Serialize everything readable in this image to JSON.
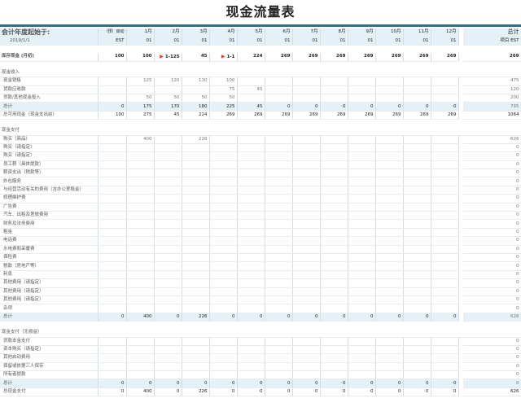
{
  "title": "现金流量表",
  "header": {
    "fiscal_label": "会计年度起始于:",
    "fiscal_date": "2019/1/1",
    "pre_label": "（预）启动",
    "pre_sub": "EST",
    "months": [
      "1月",
      "2月",
      "3月",
      "4月",
      "5月",
      "6月",
      "7月",
      "8月",
      "9月",
      "10月",
      "11月",
      "12月"
    ],
    "month_sub": "01",
    "total_label": "总计",
    "total_sub": "项目 EST"
  },
  "opening": {
    "label": "库存现金 (月初)",
    "pre": "100",
    "months": [
      "100",
      "1-125",
      "45",
      "1-1",
      "224",
      "269",
      "269",
      "269",
      "269",
      "269",
      "269",
      "269"
    ],
    "total": "269"
  },
  "receipts": {
    "section_label": "现金收入",
    "rows": [
      {
        "label": "现金销售",
        "pre": "",
        "months": [
          "125",
          "120",
          "130",
          "100",
          "",
          "",
          "",
          "",
          "",
          "",
          "",
          ""
        ],
        "total": "475"
      },
      {
        "label": "货款应收款",
        "pre": "",
        "months": [
          "",
          "",
          "",
          "75",
          "45",
          "",
          "",
          "",
          "",
          "",
          "",
          ""
        ],
        "total": "120"
      },
      {
        "label": "贷款/其他现金投入",
        "pre": "",
        "months": [
          "50",
          "50",
          "50",
          "50",
          "",
          "",
          "",
          "",
          "",
          "",
          "",
          ""
        ],
        "total": "200"
      }
    ],
    "subtotal": {
      "label": "总计",
      "pre": "0",
      "months": [
        "175",
        "170",
        "180",
        "225",
        "45",
        "0",
        "0",
        "0",
        "0",
        "0",
        "0",
        "0"
      ],
      "total": "795"
    },
    "available": {
      "label": "总可用现金（现金支出前）",
      "pre": "100",
      "months": [
        "275",
        "45",
        "224",
        "269",
        "269",
        "269",
        "269",
        "269",
        "269",
        "269",
        "269",
        "269"
      ],
      "total": "1064"
    }
  },
  "payments": {
    "section_label": "现金支付",
    "rows": [
      {
        "label": "购买（商品）",
        "pre": "",
        "months": [
          "400",
          "",
          "226",
          "",
          "",
          "",
          "",
          "",
          "",
          "",
          "",
          ""
        ],
        "total": "626"
      },
      {
        "label": "购买（请指定）",
        "pre": "",
        "months": [
          "",
          "",
          "",
          "",
          "",
          "",
          "",
          "",
          "",
          "",
          "",
          ""
        ],
        "total": "0"
      },
      {
        "label": "购买（请指定）",
        "pre": "",
        "months": [
          "",
          "",
          "",
          "",
          "",
          "",
          "",
          "",
          "",
          "",
          "",
          ""
        ],
        "total": "0"
      },
      {
        "label": "员工薪（具体提款）",
        "pre": "",
        "months": [
          "",
          "",
          "",
          "",
          "",
          "",
          "",
          "",
          "",
          "",
          "",
          ""
        ],
        "total": "0"
      },
      {
        "label": "薪资支出（税款等）",
        "pre": "",
        "months": [
          "",
          "",
          "",
          "",
          "",
          "",
          "",
          "",
          "",
          "",
          "",
          ""
        ],
        "total": "0"
      },
      {
        "label": "外包服务",
        "pre": "",
        "months": [
          "",
          "",
          "",
          "",
          "",
          "",
          "",
          "",
          "",
          "",
          "",
          ""
        ],
        "total": "0"
      },
      {
        "label": "与经营活动有关的费用（含办公室租金）",
        "pre": "",
        "months": [
          "",
          "",
          "",
          "",
          "",
          "",
          "",
          "",
          "",
          "",
          "",
          ""
        ],
        "total": "0"
      },
      {
        "label": "修理维护费",
        "pre": "",
        "months": [
          "",
          "",
          "",
          "",
          "",
          "",
          "",
          "",
          "",
          "",
          "",
          ""
        ],
        "total": "0"
      },
      {
        "label": "广告费",
        "pre": "",
        "months": [
          "",
          "",
          "",
          "",
          "",
          "",
          "",
          "",
          "",
          "",
          "",
          ""
        ],
        "total": "0"
      },
      {
        "label": "汽车、出租及差旅费用",
        "pre": "",
        "months": [
          "",
          "",
          "",
          "",
          "",
          "",
          "",
          "",
          "",
          "",
          "",
          ""
        ],
        "total": "0"
      },
      {
        "label": "财务及法务费用",
        "pre": "",
        "months": [
          "",
          "",
          "",
          "",
          "",
          "",
          "",
          "",
          "",
          "",
          "",
          ""
        ],
        "total": "0"
      },
      {
        "label": "租金",
        "pre": "",
        "months": [
          "",
          "",
          "",
          "",
          "",
          "",
          "",
          "",
          "",
          "",
          "",
          ""
        ],
        "total": "0"
      },
      {
        "label": "电话费",
        "pre": "",
        "months": [
          "",
          "",
          "",
          "",
          "",
          "",
          "",
          "",
          "",
          "",
          "",
          ""
        ],
        "total": "0"
      },
      {
        "label": "水电费和采暖费",
        "pre": "",
        "months": [
          "",
          "",
          "",
          "",
          "",
          "",
          "",
          "",
          "",
          "",
          "",
          ""
        ],
        "total": "0"
      },
      {
        "label": "保险费",
        "pre": "",
        "months": [
          "",
          "",
          "",
          "",
          "",
          "",
          "",
          "",
          "",
          "",
          "",
          ""
        ],
        "total": "0"
      },
      {
        "label": "税款（房地产等）",
        "pre": "",
        "months": [
          "",
          "",
          "",
          "",
          "",
          "",
          "",
          "",
          "",
          "",
          "",
          ""
        ],
        "total": "0"
      },
      {
        "label": "利息",
        "pre": "",
        "months": [
          "",
          "",
          "",
          "",
          "",
          "",
          "",
          "",
          "",
          "",
          "",
          ""
        ],
        "total": "0"
      },
      {
        "label": "其他费用（请指定）",
        "pre": "",
        "months": [
          "",
          "",
          "",
          "",
          "",
          "",
          "",
          "",
          "",
          "",
          "",
          ""
        ],
        "total": "0"
      },
      {
        "label": "其他费用（请指定）",
        "pre": "",
        "months": [
          "",
          "",
          "",
          "",
          "",
          "",
          "",
          "",
          "",
          "",
          "",
          ""
        ],
        "total": "0"
      },
      {
        "label": "其他费用（请指定）",
        "pre": "",
        "months": [
          "",
          "",
          "",
          "",
          "",
          "",
          "",
          "",
          "",
          "",
          "",
          ""
        ],
        "total": "0"
      },
      {
        "label": "杂项",
        "pre": "",
        "months": [
          "",
          "",
          "",
          "",
          "",
          "",
          "",
          "",
          "",
          "",
          "",
          ""
        ],
        "total": "0"
      }
    ],
    "subtotal": {
      "label": "总计",
      "pre": "0",
      "months": [
        "400",
        "0",
        "226",
        "0",
        "0",
        "0",
        "0",
        "0",
        "0",
        "0",
        "0",
        "0"
      ],
      "total": "626"
    }
  },
  "nonpl": {
    "section_label": "现金支付（无损益）",
    "rows": [
      {
        "label": "贷款本金支付",
        "pre": "",
        "months": [
          "",
          "",
          "",
          "",
          "",
          "",
          "",
          "",
          "",
          "",
          "",
          ""
        ],
        "total": "0"
      },
      {
        "label": "资本购买（请指定）",
        "pre": "",
        "months": [
          "",
          "",
          "",
          "",
          "",
          "",
          "",
          "",
          "",
          "",
          "",
          ""
        ],
        "total": "0"
      },
      {
        "label": "其他启动费用",
        "pre": "",
        "months": [
          "",
          "",
          "",
          "",
          "",
          "",
          "",
          "",
          "",
          "",
          "",
          ""
        ],
        "total": "0"
      },
      {
        "label": "保留或依第三人保存",
        "pre": "",
        "months": [
          "",
          "",
          "",
          "",
          "",
          "",
          "",
          "",
          "",
          "",
          "",
          ""
        ],
        "total": "0"
      },
      {
        "label": "所有者提款",
        "pre": "",
        "months": [
          "",
          "",
          "",
          "",
          "",
          "",
          "",
          "",
          "",
          "",
          "",
          ""
        ],
        "total": "0"
      }
    ],
    "subtotal": {
      "label": "总计",
      "pre": "0",
      "months": [
        "0",
        "0",
        "0",
        "0",
        "0",
        "0",
        "0",
        "0",
        "0",
        "0",
        "0",
        "0"
      ],
      "total": "0"
    },
    "grand": {
      "label": "总现金支付",
      "pre": "0",
      "months": [
        "400",
        "0",
        "226",
        "0",
        "0",
        "0",
        "0",
        "0",
        "0",
        "0",
        "0",
        "0"
      ],
      "total": "626"
    }
  },
  "colors": {
    "accent": "#2f6f92",
    "header_bg": "#e4f1f6",
    "negative": "#e2362e"
  }
}
